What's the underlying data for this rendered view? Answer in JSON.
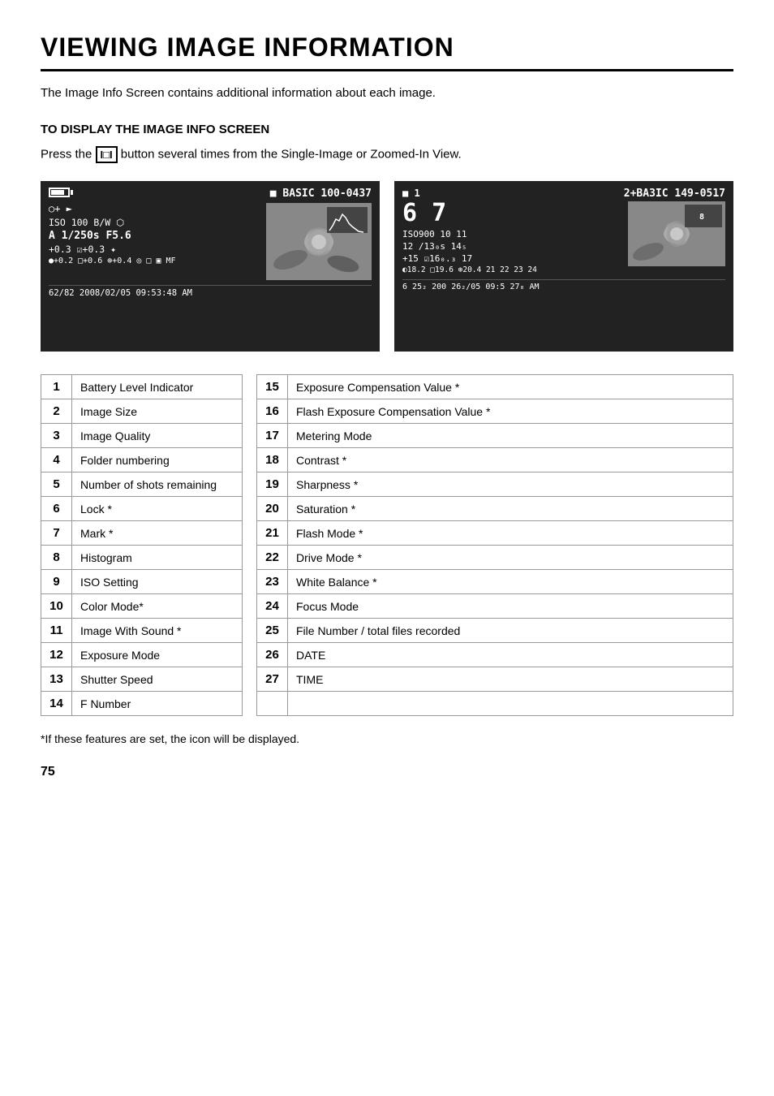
{
  "title": "VIEWING IMAGE INFORMATION",
  "intro": "The Image Info Screen contains additional information about each image.",
  "section": {
    "title": "TO DISPLAY THE IMAGE INFO SCREEN",
    "press_text": "Press the",
    "button_label": "I□I",
    "press_text2": "button several times from the Single-Image or Zoomed-In View."
  },
  "screen_left": {
    "battery": "■■■■",
    "filename": "■ BASIC 100-0437",
    "control_icon": "○+ ►",
    "iso_bw": "ISO 100  B/W  ⬡",
    "exposure": "A  1/250s    F5.6",
    "comp": "+0.3  ☑+0.3  ✦",
    "icons_row": "●+0.2  □+0.6  ⊕+0.4  ◎  □  ▣  MF",
    "date_time": "62/82       2008/02/05   09:53:48 AM"
  },
  "screen_right": {
    "top_left": "■ 1",
    "top_right": "2+BA3IC  149-0517",
    "big_numbers": "6 7",
    "histogram_label": "8",
    "iso_line": "ISO900  10  11",
    "line2": "12 /13₀s     14₅",
    "line3": "+15  ☑16₀.₃  17",
    "line4": "◐18.2  □19.6  ⊕20.4  21  22  23  24",
    "bottom": "6 25₂       200  26₂/05   09:5 27₈ AM"
  },
  "table": {
    "left": [
      {
        "num": "1",
        "label": "Battery Level Indicator"
      },
      {
        "num": "2",
        "label": "Image Size"
      },
      {
        "num": "3",
        "label": "Image Quality"
      },
      {
        "num": "4",
        "label": "Folder numbering"
      },
      {
        "num": "5",
        "label": "Number of shots remaining"
      },
      {
        "num": "6",
        "label": "Lock *"
      },
      {
        "num": "7",
        "label": "Mark *"
      },
      {
        "num": "8",
        "label": "Histogram"
      },
      {
        "num": "9",
        "label": "ISO Setting"
      },
      {
        "num": "10",
        "label": "Color Mode*"
      },
      {
        "num": "11",
        "label": "Image With Sound *"
      },
      {
        "num": "12",
        "label": "Exposure Mode"
      },
      {
        "num": "13",
        "label": "Shutter Speed"
      },
      {
        "num": "14",
        "label": "F Number"
      }
    ],
    "right": [
      {
        "num": "15",
        "label": "Exposure Compensation Value *"
      },
      {
        "num": "16",
        "label": "Flash  Exposure  Compensation Value *"
      },
      {
        "num": "17",
        "label": "Metering Mode"
      },
      {
        "num": "18",
        "label": "Contrast *"
      },
      {
        "num": "19",
        "label": "Sharpness *"
      },
      {
        "num": "20",
        "label": "Saturation *"
      },
      {
        "num": "21",
        "label": "Flash Mode *"
      },
      {
        "num": "22",
        "label": "Drive Mode *"
      },
      {
        "num": "23",
        "label": "White Balance *"
      },
      {
        "num": "24",
        "label": "Focus Mode"
      },
      {
        "num": "25",
        "label": "File Number / total files recorded"
      },
      {
        "num": "26",
        "label": "DATE"
      },
      {
        "num": "27",
        "label": "TIME"
      },
      {
        "num": "",
        "label": ""
      }
    ]
  },
  "footnote": "*If these features are set, the icon will be displayed.",
  "page_number": "75"
}
